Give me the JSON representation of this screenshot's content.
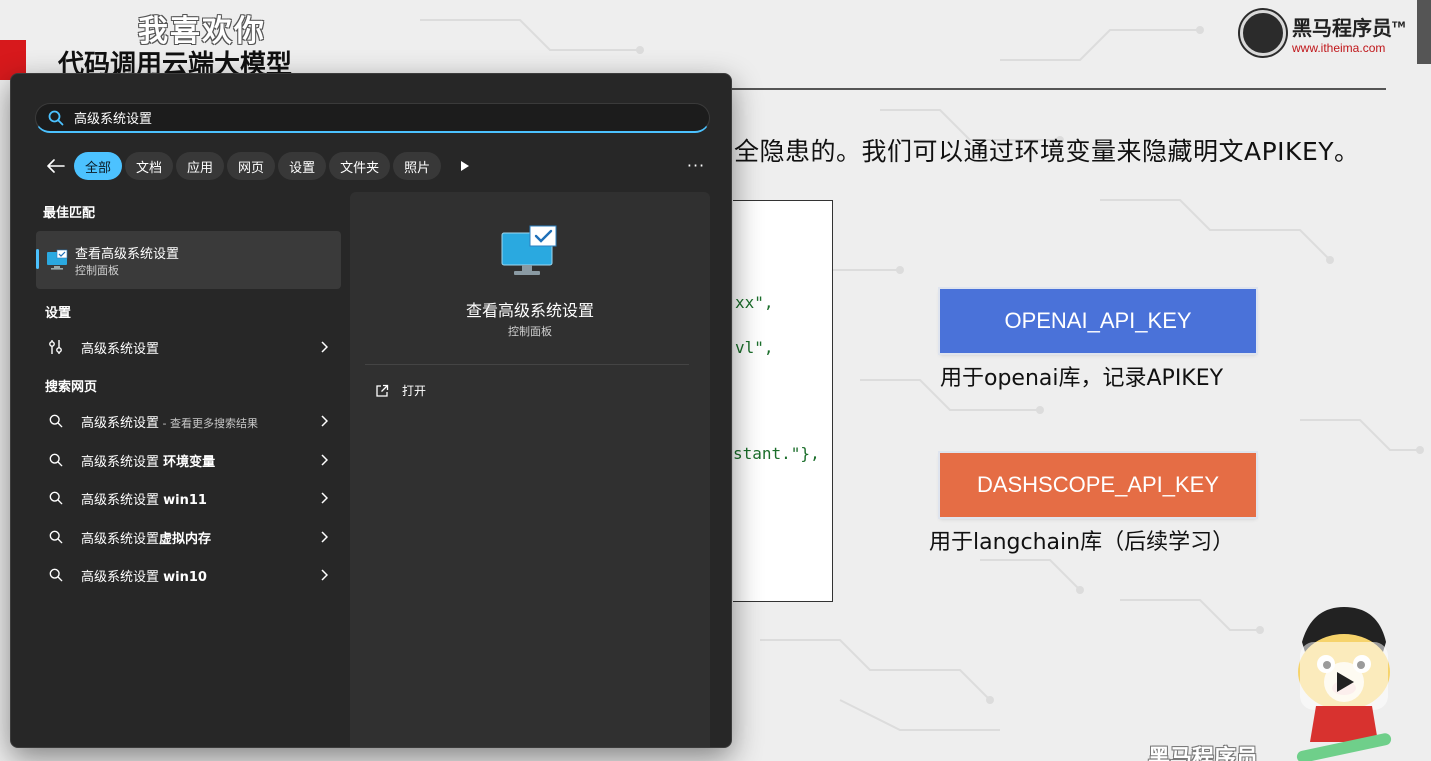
{
  "slide": {
    "watermark": "我喜欢你",
    "title": "代码调用云端大模型",
    "logo_name": "黑马程序员",
    "logo_tm": "TM",
    "logo_url": "www.itheima.com",
    "intro": "全隐患的。我们可以通过环境变量来隐藏明文APIKEY。",
    "code_lines": [
      "xx\",",
      "vl\",",
      "stant.\"},"
    ],
    "env_keys": [
      {
        "key": "OPENAI_API_KEY",
        "desc": "用于openai库，记录APIKEY",
        "color": "#4a72d9"
      },
      {
        "key": "DASHSCOPE_API_KEY",
        "desc": "用于langchain库（后续学习）",
        "color": "#e56d45"
      }
    ],
    "bottom_text": "黑马程序员"
  },
  "search": {
    "query": "高级系统设置",
    "filters": [
      "全部",
      "文档",
      "应用",
      "网页",
      "设置",
      "文件夹",
      "照片"
    ],
    "active_filter": "全部",
    "sections": {
      "best_match": "最佳匹配",
      "settings": "设置",
      "web": "搜索网页"
    },
    "best_match": {
      "title": "查看高级系统设置",
      "subtitle": "控制面板"
    },
    "settings_items": [
      {
        "label": "高级系统设置"
      }
    ],
    "web_items": [
      {
        "label": "高级系统设置",
        "suffix": " - 查看更多搜索结果"
      },
      {
        "label": "高级系统设置 ",
        "bold": "环境变量"
      },
      {
        "label": "高级系统设置 ",
        "bold": "win11"
      },
      {
        "label": "高级系统设置",
        "bold": "虚拟内存"
      },
      {
        "label": "高级系统设置 ",
        "bold": "win10"
      }
    ],
    "preview": {
      "title": "查看高级系统设置",
      "subtitle": "控制面板",
      "open_label": "打开"
    },
    "more_label": "···"
  },
  "icons": {
    "search": "search-icon",
    "back": "arrow-left-icon",
    "play": "play-icon",
    "monitor": "monitor-check-icon",
    "settings": "settings-sliders-icon",
    "chevron": "chevron-right-icon",
    "open": "open-external-icon"
  },
  "colors": {
    "accent": "#4cc2ff",
    "panel": "#272727",
    "openai": "#4a72d9",
    "dashscope": "#e56d45",
    "logo_red": "#c0161a"
  }
}
